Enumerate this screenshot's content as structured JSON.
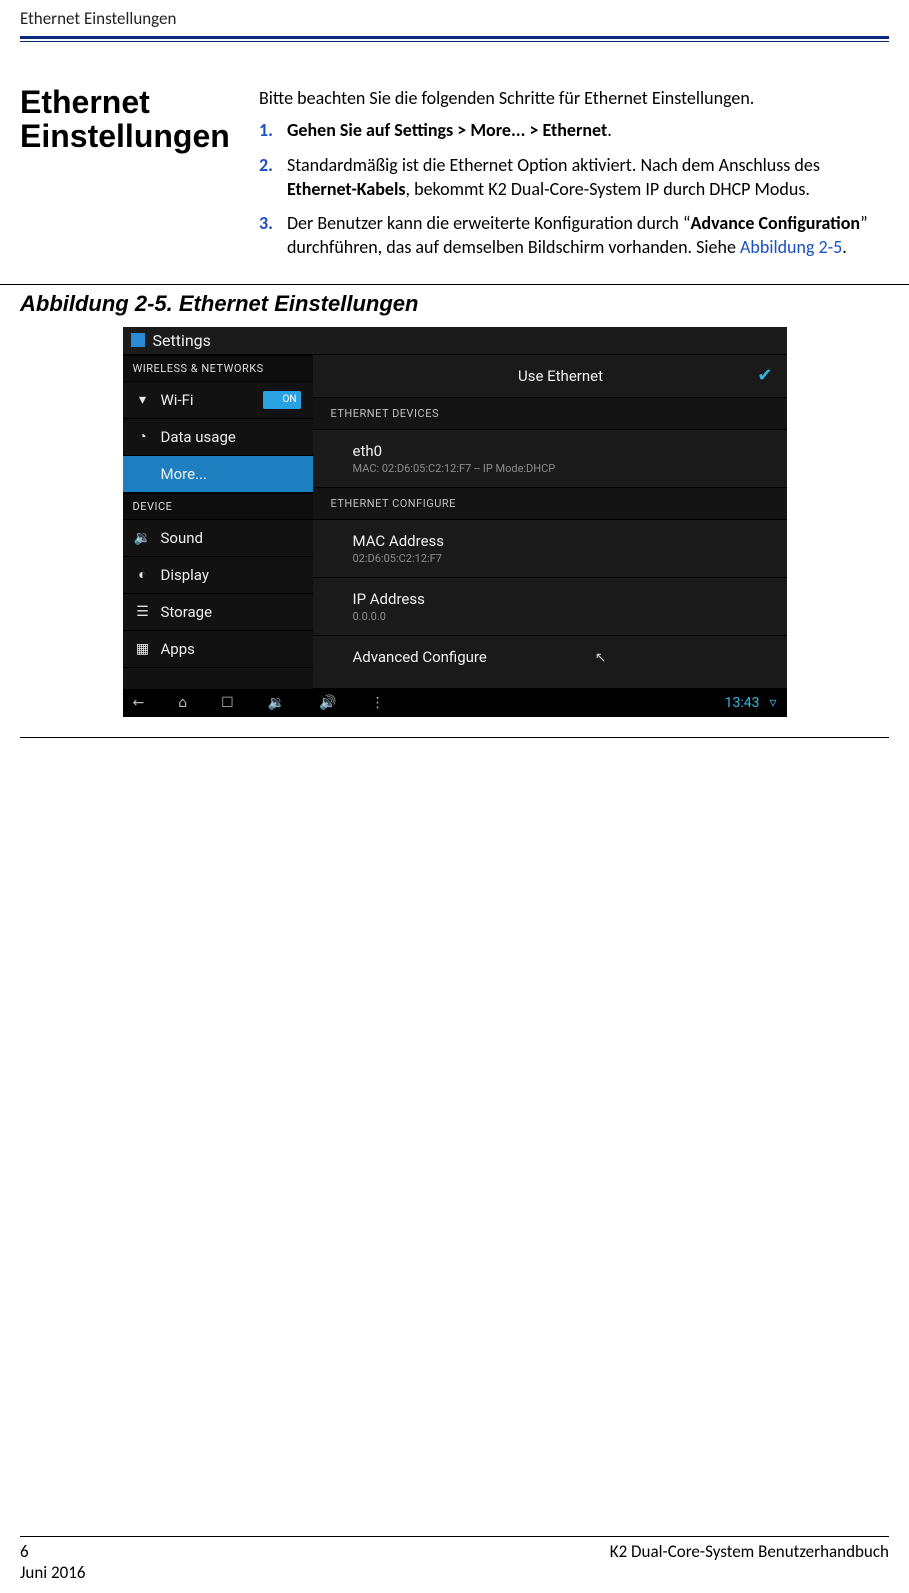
{
  "page": {
    "runningHead": "Ethernet Einstellungen",
    "number": "6",
    "manual": "K2 Dual-Core-System Benutzerhandbuch",
    "date": "Juni 2016"
  },
  "heading": "Ethernet Einstellungen",
  "intro": "Bitte beachten Sie die folgenden Schritte für Ethernet  Einstellungen.",
  "steps": {
    "n1": "1.",
    "s1_a": "Gehen Sie auf Settings  > More... > Ethernet",
    "s1_b": ".",
    "n2": "2.",
    "s2_a": "Standardmäßig ist die Ethernet  Option aktiviert.  Nach dem Anschluss des ",
    "s2_b": "Ethernet-Kabels",
    "s2_c": ",  bekommt K2 Dual-Core-System IP durch DHCP Modus.",
    "n3": "3.",
    "s3_a": "Der Benutzer kann die erweiterte Konfiguration  durch “",
    "s3_b": "Advance Configuration",
    "s3_c": "” durchführen, das auf demselben Bildschirm vorhanden. Siehe ",
    "s3_link": "Abbildung 2-5",
    "s3_d": "."
  },
  "figureCaption": "Abbildung 2-5. Ethernet Einstellungen",
  "shot": {
    "appTitle": "Settings",
    "secWireless": "WIRELESS & NETWORKS",
    "wifi": "Wi-Fi",
    "wifiSwitch": "ON",
    "dataUsage": "Data usage",
    "more": "More...",
    "secDevice": "DEVICE",
    "sound": "Sound",
    "display": "Display",
    "storage": "Storage",
    "apps": "Apps",
    "useEthernet": "Use Ethernet",
    "check": "✔",
    "hdrDevices": "ETHERNET DEVICES",
    "eth0": "eth0",
    "eth0sub": "MAC: 02:D6:05:C2:12:F7 -- IP Mode:DHCP",
    "hdrConfigure": "ETHERNET CONFIGURE",
    "mac": "MAC Address",
    "macsub": "02:D6:05:C2:12:F7",
    "ip": "IP Address",
    "ipsub": "0.0.0.0",
    "adv": "Advanced Configure",
    "cursor": "↖",
    "nav": {
      "back": "←",
      "home": "⌂",
      "recent": "☐",
      "volDown": "🔉",
      "volUp": "🔊",
      "menu": "⋮",
      "time": "13:43",
      "wifiIcon": "▿"
    }
  }
}
